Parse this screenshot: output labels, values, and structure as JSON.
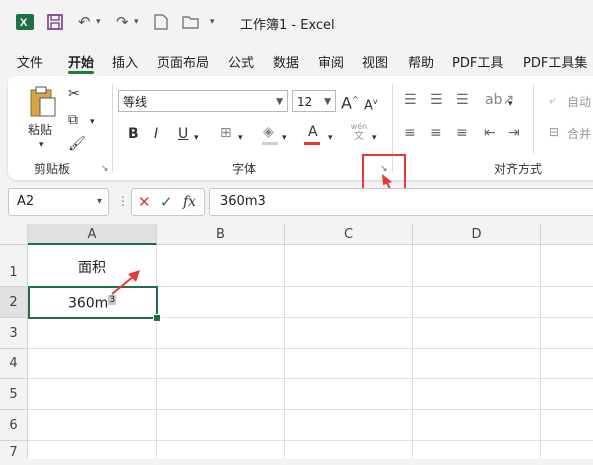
{
  "titlebar": {
    "title": "工作簿1  -  Excel",
    "app_icon": "excel-icon",
    "save_icon": "save-icon",
    "undo_icon": "undo-icon",
    "redo_icon": "redo-icon",
    "new_icon": "new-file-icon",
    "open_icon": "open-folder-icon"
  },
  "tabs": [
    "文件",
    "开始",
    "插入",
    "页面布局",
    "公式",
    "数据",
    "审阅",
    "视图",
    "帮助",
    "PDF工具",
    "PDF工具集"
  ],
  "active_tab": "开始",
  "ribbon": {
    "clipboard": {
      "paste_label": "粘贴",
      "group_label": "剪贴板"
    },
    "font": {
      "font_name": "等线",
      "font_size": "12",
      "bold": "B",
      "italic": "I",
      "underline": "U",
      "font_color_letter": "A",
      "grow_font": "A",
      "shrink_font": "A",
      "phonetic_top": "wén",
      "phonetic_bottom": "文",
      "group_label": "字体",
      "font_color": "#e53935"
    },
    "alignment": {
      "wrap_label": "自动",
      "merge_label": "合并",
      "group_label": "对齐方式"
    }
  },
  "formula_bar": {
    "name_box": "A2",
    "formula": "360m3",
    "cancel": "✕",
    "enter": "✓",
    "fx": "fx"
  },
  "sheet": {
    "columns": [
      "A",
      "B",
      "C",
      "D"
    ],
    "rows": [
      "1",
      "2",
      "3",
      "4",
      "5",
      "6",
      "7"
    ],
    "cells": {
      "A1": "面积",
      "A2": "360m",
      "A2_sup": "3"
    },
    "selection": "A2",
    "selection_color": "#1e7145"
  },
  "annotation": {
    "highlight_color": "#e53935"
  }
}
